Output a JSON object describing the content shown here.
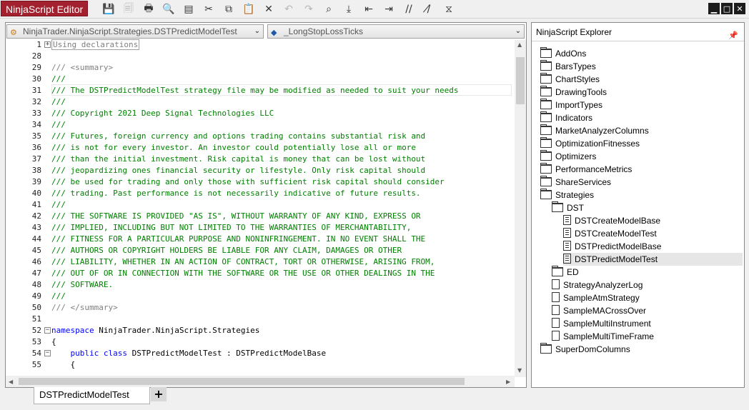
{
  "window": {
    "title": "NinjaScript Editor",
    "minimize_glyph": "▁",
    "maximize_glyph": "□",
    "close_glyph": "✕"
  },
  "toolbar": {
    "buttons": [
      {
        "name": "save-icon",
        "glyph": "💾"
      },
      {
        "name": "save-all-icon",
        "glyph": "🗐"
      },
      {
        "name": "print-icon",
        "glyph": "🖶"
      },
      {
        "name": "print-preview-icon",
        "glyph": "🔍"
      },
      {
        "name": "page-setup-icon",
        "glyph": "▤"
      },
      {
        "name": "cut-icon",
        "glyph": "✂"
      },
      {
        "name": "copy-icon",
        "glyph": "⧉"
      },
      {
        "name": "paste-icon",
        "glyph": "📋"
      },
      {
        "name": "delete-icon",
        "glyph": "✕"
      },
      {
        "name": "undo-icon",
        "glyph": "↶"
      },
      {
        "name": "redo-icon",
        "glyph": "↷"
      },
      {
        "name": "find-icon",
        "glyph": "⌕"
      },
      {
        "name": "compile-icon",
        "glyph": "⤓"
      },
      {
        "name": "outdent-icon",
        "glyph": "⇤"
      },
      {
        "name": "indent-icon",
        "glyph": "⇥"
      },
      {
        "name": "comment-icon",
        "glyph": "//"
      },
      {
        "name": "uncomment-icon",
        "glyph": "/̸"
      },
      {
        "name": "visual-studio-icon",
        "glyph": "⧖"
      }
    ]
  },
  "editor": {
    "class_combo": "NinjaTrader.NinjaScript.Strategies.DSTPredictModelTest",
    "member_combo": "_LongStopLossTicks",
    "lines": [
      {
        "n": "1",
        "fold": "+",
        "parts": [
          {
            "t": "Using declarations",
            "c": "gray-box"
          }
        ]
      },
      {
        "n": "28",
        "parts": []
      },
      {
        "n": "29",
        "parts": [
          {
            "t": "/// ",
            "c": "gray"
          },
          {
            "t": "<summary>",
            "c": "gray"
          }
        ]
      },
      {
        "n": "30",
        "parts": [
          {
            "t": "///",
            "c": "comment"
          }
        ]
      },
      {
        "n": "31",
        "parts": [
          {
            "t": "/// The DSTPredictModelTest strategy file may be modified as needed to suit your needs",
            "c": "comment"
          }
        ]
      },
      {
        "n": "32",
        "parts": [
          {
            "t": "///",
            "c": "comment"
          }
        ]
      },
      {
        "n": "33",
        "parts": [
          {
            "t": "/// Copyright 2021 Deep Signal Technologies LLC",
            "c": "comment"
          }
        ]
      },
      {
        "n": "34",
        "parts": [
          {
            "t": "///",
            "c": "comment"
          }
        ]
      },
      {
        "n": "35",
        "parts": [
          {
            "t": "/// Futures, foreign currency and options trading contains substantial risk and",
            "c": "comment"
          }
        ]
      },
      {
        "n": "36",
        "parts": [
          {
            "t": "/// is not for every investor. An investor could potentially lose all or more",
            "c": "comment"
          }
        ]
      },
      {
        "n": "37",
        "parts": [
          {
            "t": "/// than the initial investment. Risk capital is money that can be lost without",
            "c": "comment"
          }
        ]
      },
      {
        "n": "38",
        "parts": [
          {
            "t": "/// jeopardizing ones financial security or lifestyle. Only risk capital should",
            "c": "comment"
          }
        ]
      },
      {
        "n": "39",
        "parts": [
          {
            "t": "/// be used for trading and only those with sufficient risk capital should consider",
            "c": "comment"
          }
        ]
      },
      {
        "n": "40",
        "parts": [
          {
            "t": "/// trading. Past performance is not necessarily indicative of future results.",
            "c": "comment"
          }
        ]
      },
      {
        "n": "41",
        "parts": [
          {
            "t": "///",
            "c": "comment"
          }
        ]
      },
      {
        "n": "42",
        "parts": [
          {
            "t": "/// THE SOFTWARE IS PROVIDED \"AS IS\", WITHOUT WARRANTY OF ANY KIND, EXPRESS OR",
            "c": "comment"
          }
        ]
      },
      {
        "n": "43",
        "parts": [
          {
            "t": "/// IMPLIED, INCLUDING BUT NOT LIMITED TO THE WARRANTIES OF MERCHANTABILITY,",
            "c": "comment"
          }
        ]
      },
      {
        "n": "44",
        "parts": [
          {
            "t": "/// FITNESS FOR A PARTICULAR PURPOSE AND NONINFRINGEMENT. IN NO EVENT SHALL THE",
            "c": "comment"
          }
        ]
      },
      {
        "n": "45",
        "parts": [
          {
            "t": "/// AUTHORS OR COPYRIGHT HOLDERS BE LIABLE FOR ANY CLAIM, DAMAGES OR OTHER",
            "c": "comment"
          }
        ]
      },
      {
        "n": "46",
        "parts": [
          {
            "t": "/// LIABILITY, WHETHER IN AN ACTION OF CONTRACT, TORT OR OTHERWISE, ARISING FROM,",
            "c": "comment"
          }
        ]
      },
      {
        "n": "47",
        "parts": [
          {
            "t": "/// OUT OF OR IN CONNECTION WITH THE SOFTWARE OR THE USE OR OTHER DEALINGS IN THE",
            "c": "comment"
          }
        ]
      },
      {
        "n": "48",
        "parts": [
          {
            "t": "/// SOFTWARE.",
            "c": "comment"
          }
        ]
      },
      {
        "n": "49",
        "parts": [
          {
            "t": "///",
            "c": "comment"
          }
        ]
      },
      {
        "n": "50",
        "parts": [
          {
            "t": "/// </summary>",
            "c": "gray"
          }
        ]
      },
      {
        "n": "51",
        "parts": []
      },
      {
        "n": "52",
        "fold": "−",
        "parts": [
          {
            "t": "namespace",
            "c": "kw"
          },
          {
            "t": " NinjaTrader.NinjaScript.Strategies",
            "c": "plain"
          }
        ]
      },
      {
        "n": "53",
        "parts": [
          {
            "t": "{",
            "c": "plain"
          }
        ]
      },
      {
        "n": "54",
        "fold": "−",
        "parts": [
          {
            "t": "    ",
            "c": "plain"
          },
          {
            "t": "public class",
            "c": "kw"
          },
          {
            "t": " DSTPredictModelTest : DSTPredictModelBase",
            "c": "plain"
          }
        ]
      },
      {
        "n": "55",
        "parts": [
          {
            "t": "    {",
            "c": "plain"
          }
        ]
      }
    ]
  },
  "tabs": {
    "active": "DSTPredictModelTest",
    "add_glyph": "+"
  },
  "explorer": {
    "title": "NinjaScript Explorer",
    "items": [
      {
        "label": "AddOns",
        "type": "folder",
        "depth": 0
      },
      {
        "label": "BarsTypes",
        "type": "folder",
        "depth": 0
      },
      {
        "label": "ChartStyles",
        "type": "folder",
        "depth": 0
      },
      {
        "label": "DrawingTools",
        "type": "folder",
        "depth": 0
      },
      {
        "label": "ImportTypes",
        "type": "folder",
        "depth": 0
      },
      {
        "label": "Indicators",
        "type": "folder",
        "depth": 0
      },
      {
        "label": "MarketAnalyzerColumns",
        "type": "folder",
        "depth": 0
      },
      {
        "label": "OptimizationFitnesses",
        "type": "folder",
        "depth": 0
      },
      {
        "label": "Optimizers",
        "type": "folder",
        "depth": 0
      },
      {
        "label": "PerformanceMetrics",
        "type": "folder",
        "depth": 0
      },
      {
        "label": "ShareServices",
        "type": "folder",
        "depth": 0
      },
      {
        "label": "Strategies",
        "type": "folder",
        "depth": 0
      },
      {
        "label": "DST",
        "type": "folder",
        "depth": 1
      },
      {
        "label": "DSTCreateModelBase",
        "type": "doc",
        "depth": 2
      },
      {
        "label": "DSTCreateModelTest",
        "type": "doc",
        "depth": 2
      },
      {
        "label": "DSTPredictModelBase",
        "type": "doc",
        "depth": 2
      },
      {
        "label": "DSTPredictModelTest",
        "type": "doc",
        "depth": 2,
        "selected": true
      },
      {
        "label": "ED",
        "type": "folder",
        "depth": 1
      },
      {
        "label": "StrategyAnalyzerLog",
        "type": "file",
        "depth": 1
      },
      {
        "label": "SampleAtmStrategy",
        "type": "file",
        "depth": 1
      },
      {
        "label": "SampleMACrossOver",
        "type": "file",
        "depth": 1
      },
      {
        "label": "SampleMultiInstrument",
        "type": "file",
        "depth": 1
      },
      {
        "label": "SampleMultiTimeFrame",
        "type": "file",
        "depth": 1
      },
      {
        "label": "SuperDomColumns",
        "type": "folder",
        "depth": 0
      }
    ]
  },
  "colors": {
    "title_bg": "#a3212e",
    "comment": "#008000",
    "keyword": "#0000ff",
    "gray": "#7f7f7f"
  }
}
